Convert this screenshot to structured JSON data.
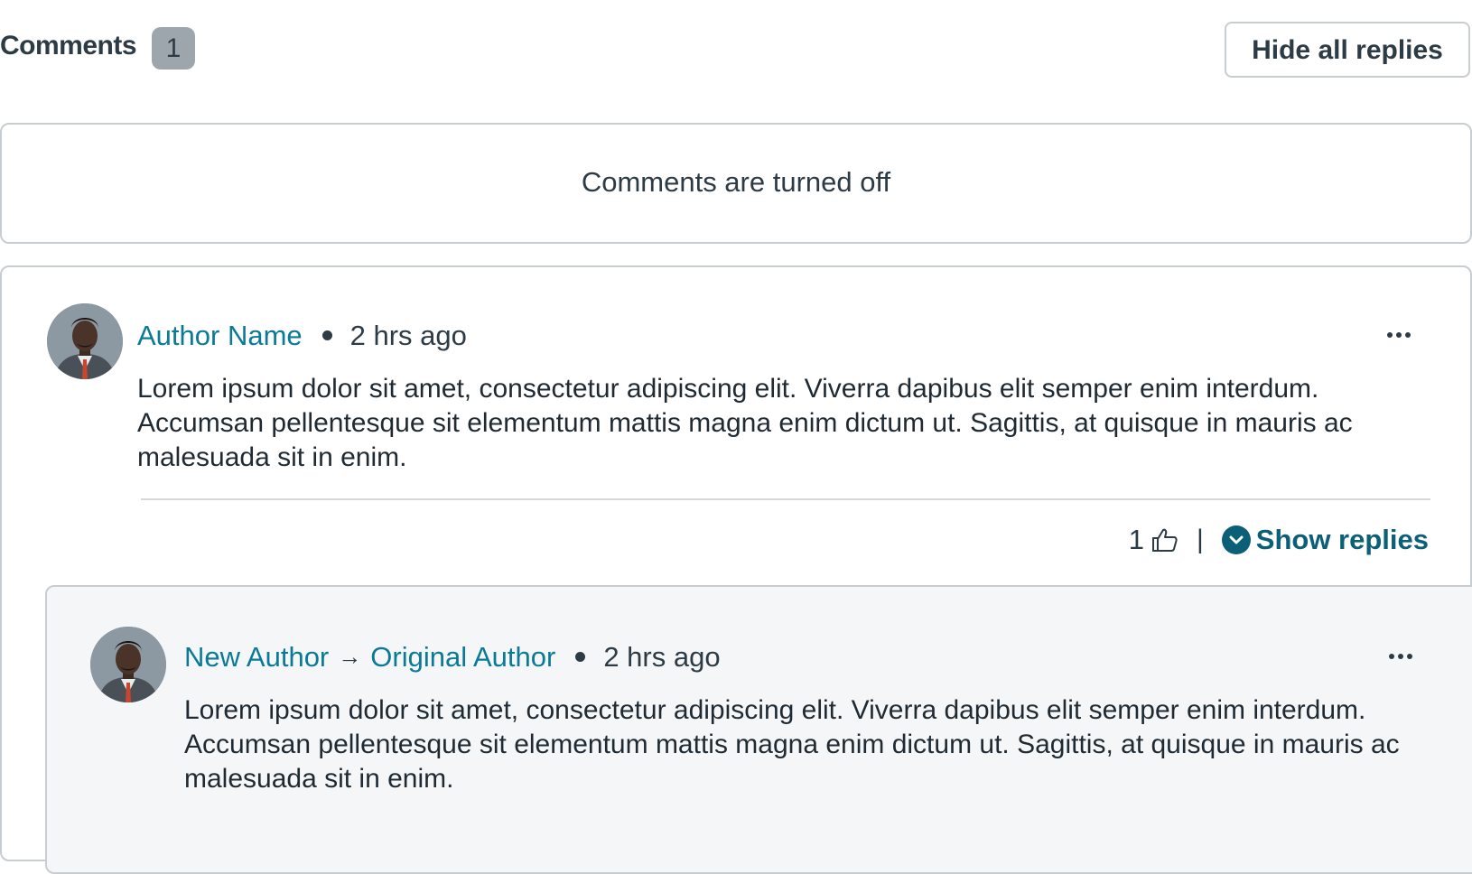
{
  "header": {
    "title": "Comments",
    "count": "1",
    "hide_replies_label": "Hide all replies"
  },
  "comments_off": {
    "text": "Comments are turned off"
  },
  "comment": {
    "author": "Author Name",
    "timestamp": "2 hrs ago",
    "body": "Lorem ipsum dolor sit amet, consectetur adipiscing elit. Viverra dapibus elit semper enim interdum. Accumsan pellentesque sit elementum mattis magna enim dictum ut. Sagittis, at quisque in mauris ac malesuada sit in enim.",
    "like_count": "1",
    "separator": "|",
    "show_replies_label": "Show replies",
    "icons": {
      "more": "more-horizontal-icon",
      "like": "thumbs-up-icon",
      "expand": "chevron-down-circle-icon"
    }
  },
  "reply": {
    "author": "New Author",
    "reply_to": "Original Author",
    "timestamp": "2 hrs ago",
    "body": "Lorem ipsum dolor sit amet, consectetur adipiscing elit. Viverra dapibus elit semper enim interdum. Accumsan pellentesque sit elementum mattis magna enim dictum ut. Sagittis, at quisque in mauris ac malesuada sit in enim.",
    "icons": {
      "arrow": "arrow-right-icon",
      "more": "more-horizontal-icon"
    }
  },
  "colors": {
    "link": "#0b7a96",
    "show_replies": "#0b5f76",
    "badge": "#9ea6ad",
    "border": "#c7cdd1",
    "reply_bg": "#f5f6f7",
    "text": "#2d3b45"
  }
}
